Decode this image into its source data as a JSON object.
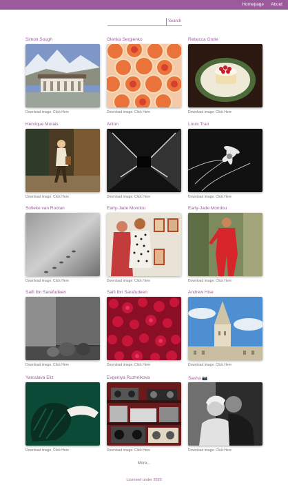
{
  "nav": {
    "homepage": "Homepage",
    "about": "About"
  },
  "search": {
    "placeholder": "",
    "button": "Search"
  },
  "download_label": "Download image: Click Here",
  "cards": [
    {
      "name": "Simon Sough"
    },
    {
      "name": "Olenka Sergienko"
    },
    {
      "name": "Rebecca Grote"
    },
    {
      "name": "Henrique Morais"
    },
    {
      "name": "Anton"
    },
    {
      "name": "Louis Tran"
    },
    {
      "name": "Sofieke van Rootan"
    },
    {
      "name": "Early-Jade Mondou"
    },
    {
      "name": "Early-Jade Mondou"
    },
    {
      "name": "Saifi Ibn Sarafudeen"
    },
    {
      "name": "Saifi Ibn Sarafudeen"
    },
    {
      "name": "Andrew Hise"
    },
    {
      "name": "Yaroslava Eliz"
    },
    {
      "name": "Evgeniya Ruzhnikova"
    },
    {
      "name": "Sasha 📷"
    }
  ],
  "more": "More...",
  "footer": "Licensed under 2020"
}
